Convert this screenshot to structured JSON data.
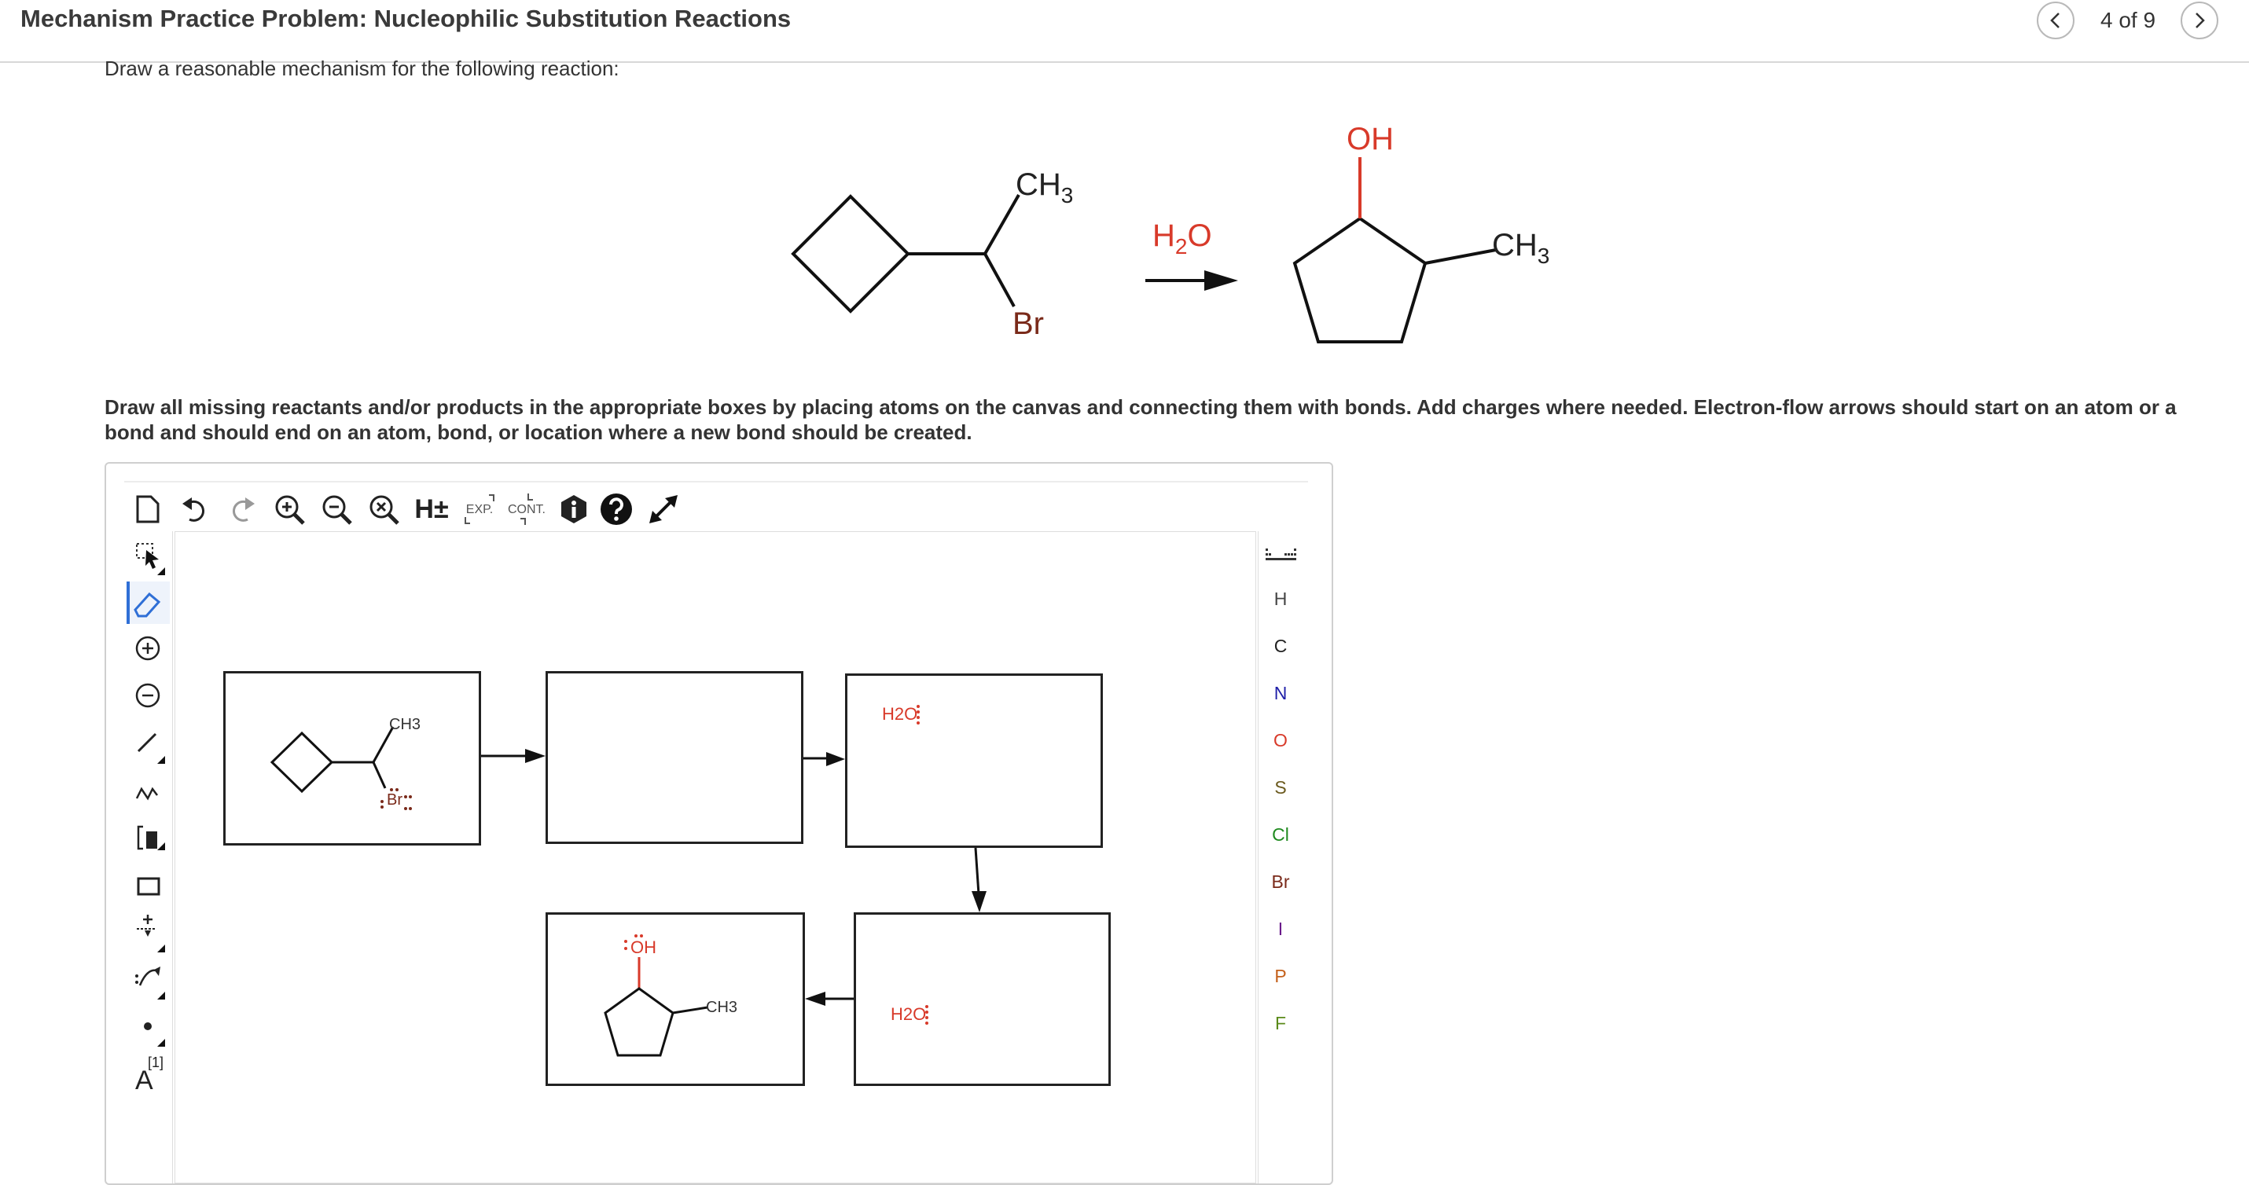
{
  "header": {
    "title": "Mechanism Practice Problem: Nucleophilic Substitution Reactions",
    "page_count": "4 of 9"
  },
  "prompt": "Draw a reasonable mechanism for the following reaction:",
  "reaction": {
    "reactant_label_ch3": "CH3",
    "reactant_label_br": "Br",
    "reagent": "H2O",
    "product_label_oh": "OH",
    "product_label_ch3": "CH3"
  },
  "instructions": "Draw all missing reactants and/or products in the appropriate boxes by placing atoms on the canvas and connecting them with bonds. Add charges where needed. Electron-flow arrows should start on an atom or a bond and should end on an atom, bond, or location where a new bond should be created.",
  "toolbar": {
    "explicit_label": "EXP.",
    "contract_label": "CONT.",
    "hydrogen_label": "H±"
  },
  "atoms": [
    "H",
    "C",
    "N",
    "O",
    "S",
    "Cl",
    "Br",
    "I",
    "P",
    "F"
  ],
  "atom_colors": {
    "H": "#444444",
    "C": "#222222",
    "N": "#1f1fa8",
    "O": "#d83a2a",
    "S": "#6b5a1e",
    "Cl": "#1f8a1f",
    "Br": "#7a2a1a",
    "I": "#6a1a8a",
    "P": "#c4601a",
    "F": "#5a8a1a"
  },
  "canvas": {
    "box1_ch3": "CH3",
    "box1_br": "Br",
    "box3_water": "H2O",
    "box4_water": "H2O",
    "box5_oh": "OH",
    "box5_ch3": "CH3"
  },
  "left_tools": {
    "charge_label": "[1]",
    "text_tool": "A"
  },
  "colors": {
    "oxygen": "#d83a2a",
    "bromine": "#7a2a1a",
    "selected_tool": "#2f6fd6"
  }
}
